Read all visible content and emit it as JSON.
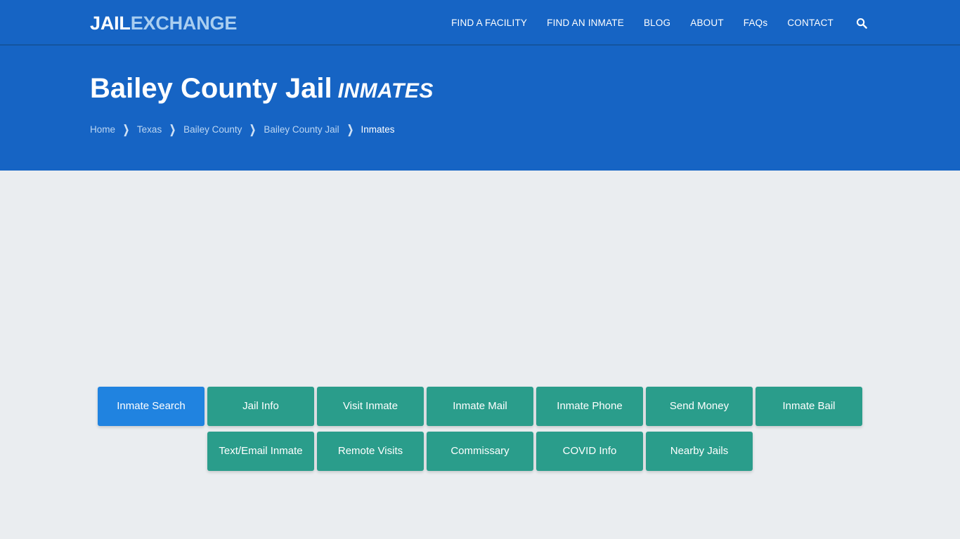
{
  "brand": {
    "logo_primary": "JAIL",
    "logo_secondary": "EXCHANGE"
  },
  "nav": {
    "items": [
      {
        "label": "FIND A FACILITY"
      },
      {
        "label": "FIND AN INMATE"
      },
      {
        "label": "BLOG"
      },
      {
        "label": "ABOUT"
      },
      {
        "label": "FAQs"
      },
      {
        "label": "CONTACT"
      }
    ],
    "search_icon": "search-icon"
  },
  "hero": {
    "title": "Bailey County Jail",
    "title_suffix": "INMATES",
    "breadcrumb": [
      {
        "label": "Home",
        "current": false
      },
      {
        "label": "Texas",
        "current": false
      },
      {
        "label": "Bailey County",
        "current": false
      },
      {
        "label": "Bailey County Jail",
        "current": false
      },
      {
        "label": "Inmates",
        "current": true
      }
    ],
    "separator": "❯"
  },
  "tabs": {
    "row1": [
      {
        "label": "Inmate Search",
        "active": true
      },
      {
        "label": "Jail Info",
        "active": false
      },
      {
        "label": "Visit Inmate",
        "active": false
      },
      {
        "label": "Inmate Mail",
        "active": false
      },
      {
        "label": "Inmate Phone",
        "active": false
      },
      {
        "label": "Send Money",
        "active": false
      },
      {
        "label": "Inmate Bail",
        "active": false
      }
    ],
    "row2": [
      {
        "label": "Text/Email Inmate",
        "active": false
      },
      {
        "label": "Remote Visits",
        "active": false
      },
      {
        "label": "Commissary",
        "active": false
      },
      {
        "label": "COVID Info",
        "active": false
      },
      {
        "label": "Nearby Jails",
        "active": false
      }
    ]
  },
  "colors": {
    "header_blue": "#1664c4",
    "navbar_border": "#14559f",
    "accent_teal": "#2a9d8b",
    "active_blue": "#2083e0",
    "page_background": "#eaedf0",
    "logo_secondary": "#a9cef0",
    "breadcrumb_link": "#bcd6f2"
  }
}
